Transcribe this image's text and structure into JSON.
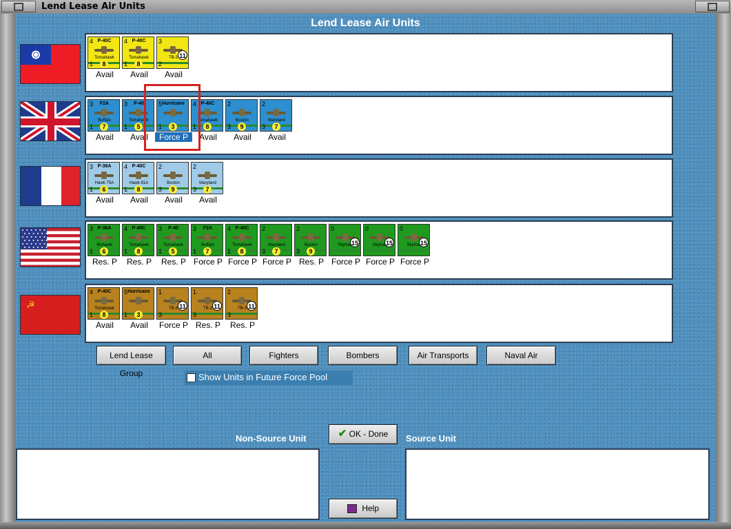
{
  "window": {
    "title": "Lend Lease Air Units"
  },
  "main_title": "Lend Lease Air Units",
  "nations": [
    {
      "flag": "china-flag",
      "units": [
        {
          "top_left": "4",
          "model": "P-40C",
          "name": "Tomahawk",
          "bottom_left": "1",
          "badge": "8",
          "color": "#f2e614",
          "status": "Avail"
        },
        {
          "top_left": "4",
          "model": "P-40C",
          "name": "Tomahawk",
          "bottom_left": "1",
          "badge": "8",
          "color": "#f2e614",
          "status": "Avail"
        },
        {
          "top_left": "3",
          "model": "",
          "name": "TB-3",
          "bottom_left": "2",
          "badge": "11",
          "color": "#f2e614",
          "status": "Avail"
        }
      ]
    },
    {
      "flag": "uk-flag",
      "units": [
        {
          "top_left": "3",
          "model": "F2A",
          "name": "Buffalo",
          "bottom_left": "1",
          "badge": "7",
          "color": "#2d8fcf",
          "status": "Avail"
        },
        {
          "top_left": "3",
          "model": "P-40",
          "name": "Tomahawk",
          "bottom_left": "1",
          "badge": "5",
          "color": "#2d8fcf",
          "status": "Avail"
        },
        {
          "top_left": "5",
          "model": "Hurricane",
          "name": "",
          "bottom_left": "1",
          "badge": "3",
          "color": "#2d8fcf",
          "status": "Force P"
        },
        {
          "top_left": "4",
          "model": "P-40C",
          "name": "Tomahawk",
          "bottom_left": "1",
          "badge": "8",
          "color": "#2d8fcf",
          "status": "Avail"
        },
        {
          "top_left": "2",
          "model": "",
          "name": "Boston",
          "bottom_left": "3",
          "badge": "9",
          "color": "#2d8fcf",
          "status": "Avail"
        },
        {
          "top_left": "2",
          "model": "",
          "name": "Maryland",
          "bottom_left": "3",
          "badge": "7",
          "color": "#2d8fcf",
          "status": "Avail"
        }
      ]
    },
    {
      "flag": "france-flag",
      "units": [
        {
          "top_left": "3",
          "model": "P-36A",
          "name": "Hawk 75A",
          "bottom_left": "1",
          "badge": "6",
          "color": "#9fcbe8",
          "status": "Avail"
        },
        {
          "top_left": "4",
          "model": "P-40C",
          "name": "Hawk 81A",
          "bottom_left": "1",
          "badge": "8",
          "color": "#9fcbe8",
          "status": "Avail"
        },
        {
          "top_left": "2",
          "model": "",
          "name": "Boston",
          "bottom_left": "3",
          "badge": "9",
          "color": "#9fcbe8",
          "status": "Avail"
        },
        {
          "top_left": "2",
          "model": "",
          "name": "Maryland",
          "bottom_left": "3",
          "badge": "7",
          "color": "#9fcbe8",
          "status": "Avail"
        }
      ]
    },
    {
      "flag": "usa-flag",
      "units": [
        {
          "top_left": "3",
          "model": "P-36A",
          "name": "Mohawk",
          "bottom_left": "1",
          "badge": "6",
          "color": "#1f9a1f",
          "status": "Res. P"
        },
        {
          "top_left": "4",
          "model": "P-40C",
          "name": "Tomahawk",
          "bottom_left": "1",
          "badge": "8",
          "color": "#1f9a1f",
          "status": "Res. P"
        },
        {
          "top_left": "3",
          "model": "P-40",
          "name": "Tomahawk",
          "bottom_left": "1",
          "badge": "5",
          "color": "#1f9a1f",
          "status": "Res. P"
        },
        {
          "top_left": "3",
          "model": "F2A",
          "name": "Buffalo",
          "bottom_left": "1",
          "badge": "7",
          "color": "#1f9a1f",
          "status": "Force P"
        },
        {
          "top_left": "4",
          "model": "P-40C",
          "name": "Tomahawk",
          "bottom_left": "1",
          "badge": "8",
          "color": "#1f9a1f",
          "status": "Force P"
        },
        {
          "top_left": "2",
          "model": "",
          "name": "Maryland",
          "bottom_left": "3",
          "badge": "7",
          "color": "#1f9a1f",
          "status": "Force P"
        },
        {
          "top_left": "2",
          "model": "",
          "name": "Boston",
          "bottom_left": "3",
          "badge": "9",
          "color": "#1f9a1f",
          "status": "Res. P"
        },
        {
          "top_left": "0",
          "model": "",
          "name": "Skytrain",
          "bottom_left": "",
          "badge": "15",
          "color": "#1f9a1f",
          "status": "Force P"
        },
        {
          "top_left": "0",
          "model": "",
          "name": "Skytrain",
          "bottom_left": "",
          "badge": "15",
          "color": "#1f9a1f",
          "status": "Force P"
        },
        {
          "top_left": "0",
          "model": "",
          "name": "Skytrain",
          "bottom_left": "",
          "badge": "15",
          "color": "#1f9a1f",
          "status": "Force P"
        }
      ]
    },
    {
      "flag": "ussr-flag",
      "units": [
        {
          "top_left": "4",
          "model": "P-40C",
          "name": "Tomahawk",
          "bottom_left": "1",
          "badge": "8",
          "color": "#b8821e",
          "status": "Avail"
        },
        {
          "top_left": "5",
          "model": "Hurricane",
          "name": "",
          "bottom_left": "1",
          "badge": "3",
          "color": "#b8821e",
          "status": "Avail"
        },
        {
          "top_left": "1",
          "model": "",
          "name": "TB-3",
          "bottom_left": "3",
          "badge": "11",
          "color": "#b8821e",
          "status": "Force P"
        },
        {
          "top_left": "1",
          "model": "",
          "name": "TB-3",
          "bottom_left": "3",
          "badge": "11",
          "color": "#b8821e",
          "status": "Res. P"
        },
        {
          "top_left": "2",
          "model": "",
          "name": "TB-3",
          "bottom_left": "3",
          "badge": "11",
          "color": "#b8821e",
          "status": "Res. P"
        }
      ]
    }
  ],
  "filters": {
    "lend_lease_group": "Lend Lease Group",
    "all": "All",
    "fighters": "Fighters",
    "bombers": "Bombers",
    "air_transports": "Air Transports",
    "naval_air": "Naval Air"
  },
  "future_pool": {
    "label": "Show Units in Future Force Pool",
    "checked": false
  },
  "non_source_label": "Non-Source Unit",
  "source_label": "Source Unit",
  "ok_button": "OK - Done",
  "help_button": "Help"
}
